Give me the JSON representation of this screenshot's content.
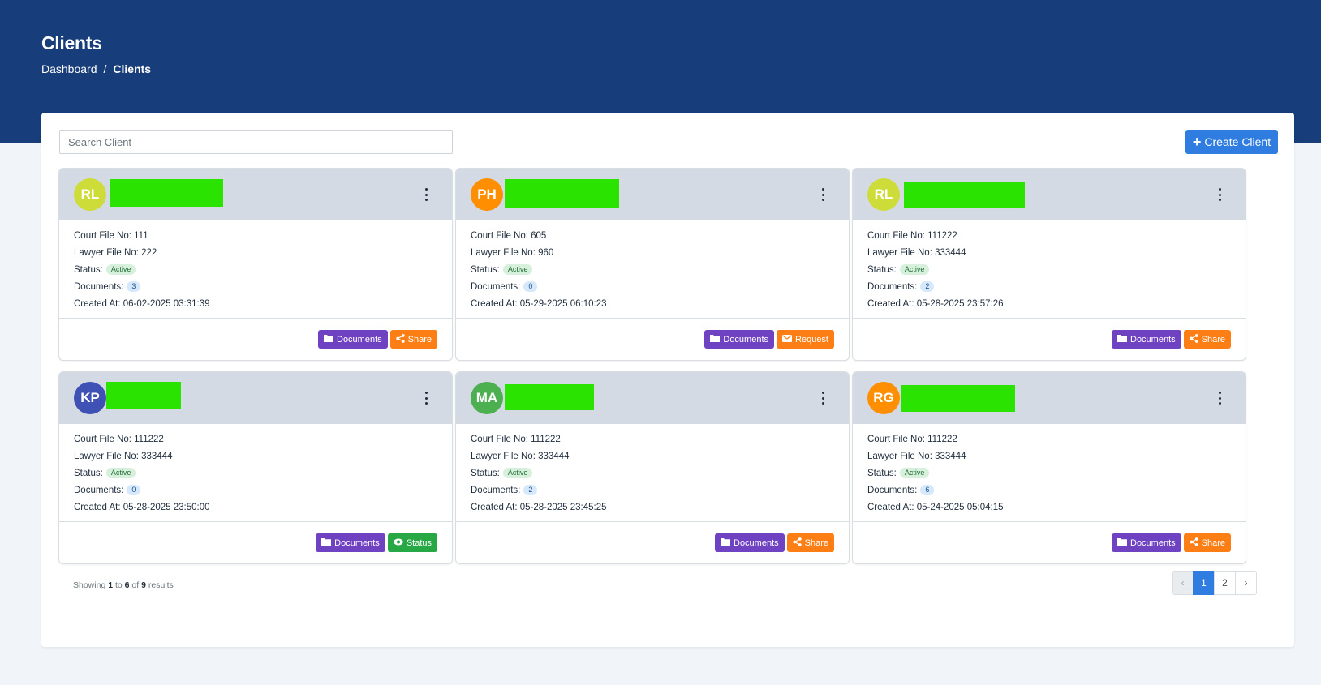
{
  "header": {
    "title": "Clients",
    "breadcrumb": {
      "home": "Dashboard",
      "separator": "/",
      "current": "Clients"
    }
  },
  "toolbar": {
    "search_placeholder": "Search Client",
    "create_label": "Create Client"
  },
  "labels": {
    "court_file": "Court File No:",
    "lawyer_file": "Lawyer File No:",
    "status": "Status:",
    "documents": "Documents:",
    "created_at": "Created At:"
  },
  "clients": [
    {
      "initials": "RL",
      "avatar_color": "#cddc39",
      "court_file": "111",
      "lawyer_file": "222",
      "status": "Active",
      "documents": "3",
      "created_at": "06-02-2025 03:31:39",
      "actions": [
        {
          "label": "Documents",
          "icon": "folder-icon",
          "color": "#6f42c1"
        },
        {
          "label": "Share",
          "icon": "share-icon",
          "color": "#fd7e14"
        }
      ]
    },
    {
      "initials": "PH",
      "avatar_color": "#ff8f00",
      "court_file": "605",
      "lawyer_file": "960",
      "status": "Active",
      "documents": "0",
      "created_at": "05-29-2025 06:10:23",
      "actions": [
        {
          "label": "Documents",
          "icon": "folder-icon",
          "color": "#6f42c1"
        },
        {
          "label": "Request",
          "icon": "envelope-icon",
          "color": "#fd7e14"
        }
      ]
    },
    {
      "initials": "RL",
      "avatar_color": "#cddc39",
      "court_file": "111222",
      "lawyer_file": "333444",
      "status": "Active",
      "documents": "2",
      "created_at": "05-28-2025 23:57:26",
      "actions": [
        {
          "label": "Documents",
          "icon": "folder-icon",
          "color": "#6f42c1"
        },
        {
          "label": "Share",
          "icon": "share-icon",
          "color": "#fd7e14"
        }
      ]
    },
    {
      "initials": "KP",
      "avatar_color": "#3f51b5",
      "court_file": "111222",
      "lawyer_file": "333444",
      "status": "Active",
      "documents": "0",
      "created_at": "05-28-2025 23:50:00",
      "actions": [
        {
          "label": "Documents",
          "icon": "folder-icon",
          "color": "#6f42c1"
        },
        {
          "label": "Status",
          "icon": "eye-icon",
          "color": "#28a745"
        }
      ]
    },
    {
      "initials": "MA",
      "avatar_color": "#4caf50",
      "court_file": "111222",
      "lawyer_file": "333444",
      "status": "Active",
      "documents": "2",
      "created_at": "05-28-2025 23:45:25",
      "actions": [
        {
          "label": "Documents",
          "icon": "folder-icon",
          "color": "#6f42c1"
        },
        {
          "label": "Share",
          "icon": "share-icon",
          "color": "#fd7e14"
        }
      ]
    },
    {
      "initials": "RG",
      "avatar_color": "#ff8f00",
      "court_file": "111222",
      "lawyer_file": "333444",
      "status": "Active",
      "documents": "6",
      "created_at": "05-24-2025 05:04:15",
      "actions": [
        {
          "label": "Documents",
          "icon": "folder-icon",
          "color": "#6f42c1"
        },
        {
          "label": "Share",
          "icon": "share-icon",
          "color": "#fd7e14"
        }
      ]
    }
  ],
  "pagination": {
    "showing": "Showing",
    "from": "1",
    "to_word": "to",
    "to": "6",
    "of_word": "of",
    "total": "9",
    "results_word": "results",
    "prev": "‹",
    "pages": [
      "1",
      "2"
    ],
    "current": "1",
    "next": "›"
  }
}
